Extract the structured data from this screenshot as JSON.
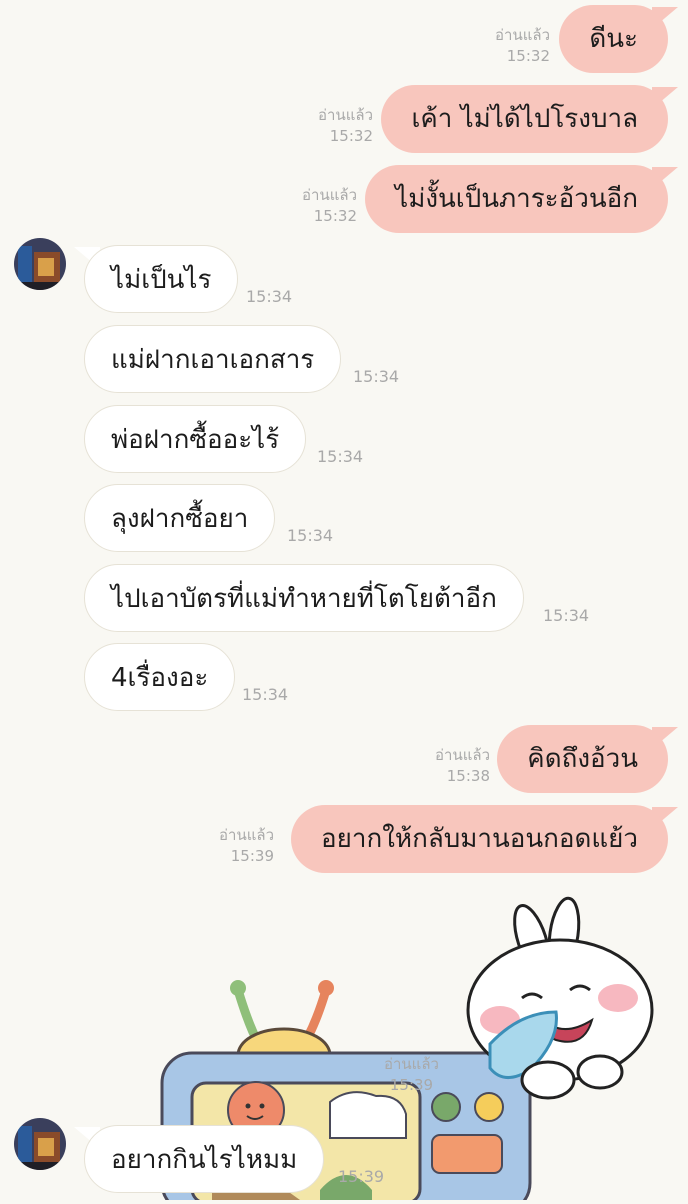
{
  "chat": {
    "read_label": "อ่านแล้ว",
    "messages": [
      {
        "dir": "out",
        "text": "ดีนะ",
        "time": "15:32"
      },
      {
        "dir": "out",
        "text": "เค้า ไม่ได้ไปโรงบาล",
        "time": "15:32"
      },
      {
        "dir": "out",
        "text": "ไม่งั้นเป็นภาระอ้วนอีก",
        "time": "15:32"
      },
      {
        "dir": "in",
        "text": "ไม่เป็นไร",
        "time": "15:34"
      },
      {
        "dir": "in",
        "text": "แม่ฝากเอาเอกสาร",
        "time": "15:34"
      },
      {
        "dir": "in",
        "text": "พ่อฝากซื้ออะไร้",
        "time": "15:34"
      },
      {
        "dir": "in",
        "text": "ลุงฝากซื้อยา",
        "time": "15:34"
      },
      {
        "dir": "in",
        "text": "ไปเอาบัตรที่แม่ทำหายที่โตโยต้าอีก",
        "time": "15:34"
      },
      {
        "dir": "in",
        "text": "4เรื่องอะ",
        "time": "15:34"
      },
      {
        "dir": "out",
        "text": "คิดถึงอ้วน",
        "time": "15:38"
      },
      {
        "dir": "out",
        "text": "อยากให้กลับมานอนกอดแย้ว",
        "time": "15:39"
      }
    ],
    "sticker": {
      "read": "อ่านแล้ว",
      "time": "15:39",
      "name": "crying-bunny-and-tv-sticker"
    },
    "last": {
      "text": "อยากกินไรไหมม",
      "time": "15:39"
    }
  },
  "colors": {
    "outgoing": "#f8c6bd",
    "incoming": "#ffffff",
    "background": "#f9f8f3"
  }
}
